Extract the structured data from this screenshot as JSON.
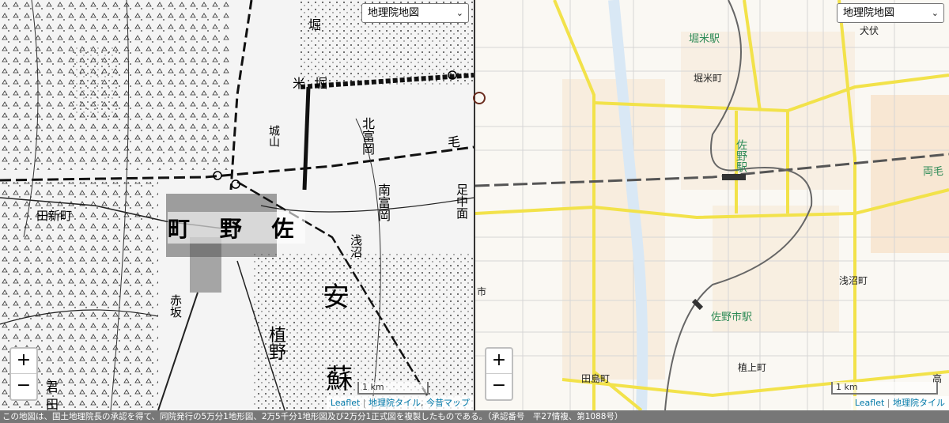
{
  "left_map": {
    "layer_select": "地理院地図",
    "zoom_in": "+",
    "zoom_out": "−",
    "scale_label": "1 km",
    "attribution": {
      "leaflet": "Leaflet",
      "sep": "|",
      "gsi": "地理院タイル",
      "comma": ",",
      "konjaku": "今昔マップ"
    },
    "labels": {
      "sano_machi": "町 野 佐",
      "yasu": "安",
      "so": "蘇",
      "kita_tomioka": "北富岡",
      "minami_tomioka": "南富岡",
      "yonehori": "米堀",
      "tanaka": "田新町",
      "akasaka": "赤坂",
      "ueno": "植野",
      "ta": "田",
      "kimi": "君",
      "hori": "堀",
      "asanuma": "浅沼",
      "toyoashi": "足中面",
      "shiroyama": "城山",
      "ge": "毛"
    }
  },
  "right_map": {
    "layer_select": "地理院地図",
    "zoom_in": "+",
    "zoom_out": "−",
    "scale_label": "1 km",
    "attribution": {
      "leaflet": "Leaflet",
      "sep": "|",
      "gsi": "地理院タイル"
    },
    "labels": {
      "horigome_eki": "堀米駅",
      "horigome_cho": "堀米町",
      "sano_eki": "佐野駅",
      "sanoshi_eki": "佐野市駅",
      "asanuma_cho": "浅沼町",
      "ueno_cho": "植上町",
      "tajima_cho": "田島町",
      "inubushi": "犬伏",
      "ryomo": "両毛",
      "ichi": "市",
      "taka": "高"
    }
  },
  "footer": "この地図は、国土地理院長の承認を得て、同院発行の5万分1地形図、2万5千分1地形図及び2万分1正式図を複製したものである。（承認番号　平27情複、第1088号）",
  "colors": {
    "road_yellow": "#f2e24a",
    "river_blue": "#cfe2f3",
    "station_green": "#2e8b57"
  }
}
